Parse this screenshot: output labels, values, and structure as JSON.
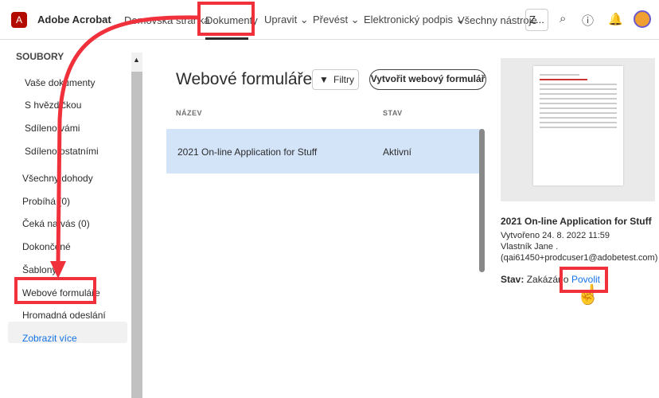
{
  "header": {
    "brand": "Adobe Acrobat",
    "nav": [
      "Domovská stránka",
      "Dokumenty",
      "Upravit ⌄",
      "Převést ⌄",
      "Elektronický podpis ⌄",
      "Všechny nástroje"
    ],
    "more_btn": "Z..."
  },
  "sidebar": {
    "heading": "SOUBORY",
    "items": [
      "Vaše dokumenty",
      "S hvězdičkou",
      "Sdíleno vámi",
      "Sdíleno ostatními",
      "Všechny dohody",
      "Probíhá (0)",
      "Čeká na vás (0)",
      "Dokončené",
      "Šablony",
      "Webové formuláře",
      "Hromadná odeslání"
    ],
    "show_more": "Zobrazit více"
  },
  "main": {
    "title": "Webové formuláře",
    "filter": "Filtry",
    "create": "Vytvořit webový formulář",
    "columns": [
      "NÁZEV",
      "STAV"
    ],
    "rows": [
      {
        "name": "2021 On-line Application for Stuff",
        "status": "Aktivní"
      }
    ]
  },
  "details": {
    "title": "2021 On-line Application for Stuff",
    "created": "Vytvořeno 24. 8. 2022 11:59",
    "owner": "Vlastník Jane .",
    "email": "(qai61450+prodcuser1@adobetest.com)",
    "status_label": "Stav:",
    "status_value": "Zakázáno",
    "enable": "Povolit"
  },
  "colors": {
    "accent": "#1473e6",
    "highlight": "#f0303a",
    "selected_row": "#d3e3f8"
  }
}
